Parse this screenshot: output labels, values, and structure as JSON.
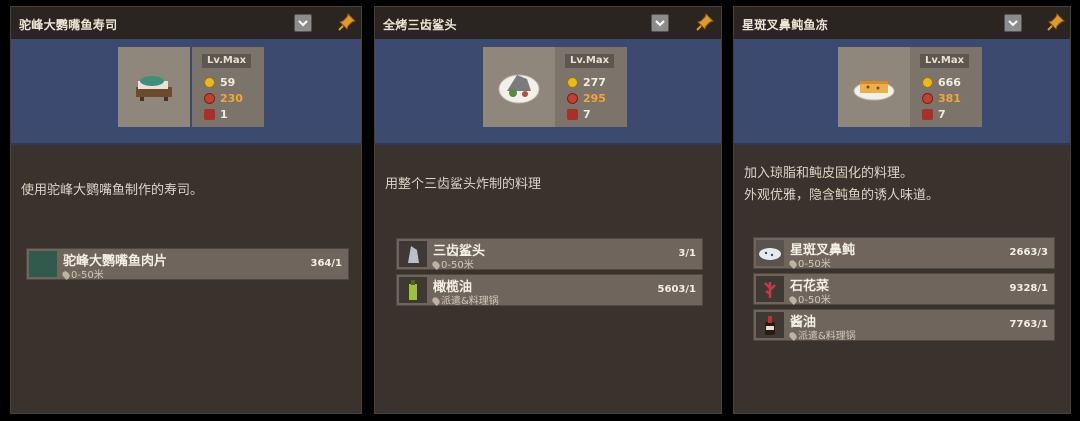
{
  "panels": [
    {
      "title": "驼峰大鹦嘴鱼寿司",
      "level": "Lv.Max",
      "stats": [
        "59",
        "230",
        "1"
      ],
      "description": "使用驼峰大鹦嘴鱼制作的寿司。",
      "ingredients": [
        {
          "name": "驼峰大鹦嘴鱼肉片",
          "location": "0-50米",
          "count": "364/1"
        }
      ]
    },
    {
      "title": "全烤三齿鲨头",
      "level": "Lv.Max",
      "stats": [
        "277",
        "295",
        "7"
      ],
      "description": "用整个三齿鲨头炸制的料理",
      "ingredients": [
        {
          "name": "三齿鲨头",
          "location": "0-50米",
          "count": "3/1"
        },
        {
          "name": "橄榄油",
          "location": "派遣&料理锅",
          "count": "5603/1"
        }
      ]
    },
    {
      "title": "星斑叉鼻鲀鱼冻",
      "level": "Lv.Max",
      "stats": [
        "666",
        "381",
        "7"
      ],
      "description": "加入琼脂和鲀皮固化的料理。\n外观优雅，隐含鲀鱼的诱人味道。",
      "ingredients": [
        {
          "name": "星斑叉鼻鲀",
          "location": "0-50米",
          "count": "2663/3"
        },
        {
          "name": "石花菜",
          "location": "0-50米",
          "count": "9328/1"
        },
        {
          "name": "酱油",
          "location": "派遣&料理锅",
          "count": "7763/1"
        }
      ]
    }
  ]
}
